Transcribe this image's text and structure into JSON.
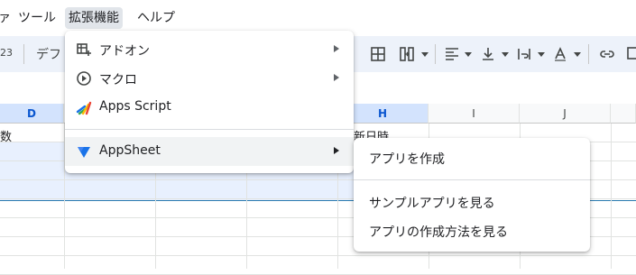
{
  "menubar": {
    "items": [
      {
        "label": "ァ"
      },
      {
        "label": "ツール"
      },
      {
        "label": "拡張機能"
      },
      {
        "label": "ヘルプ"
      }
    ]
  },
  "toolbar": {
    "num_format": "23",
    "font": "デフ"
  },
  "columns": [
    {
      "label": "D"
    },
    {
      "label": ""
    },
    {
      "label": ""
    },
    {
      "label": ""
    },
    {
      "label": "H"
    },
    {
      "label": "I"
    },
    {
      "label": "J"
    },
    {
      "label": ""
    }
  ],
  "cells": {
    "d1": "数",
    "h1": "新日時"
  },
  "extensions_menu": {
    "items": [
      {
        "label": "アドオン",
        "icon": "addon-icon"
      },
      {
        "label": "マクロ",
        "icon": "macro-icon"
      },
      {
        "label": "Apps Script",
        "icon": "apps-script-icon"
      },
      {
        "label": "AppSheet",
        "icon": "appsheet-icon"
      }
    ]
  },
  "appsheet_submenu": {
    "items": [
      {
        "label": "アプリを作成"
      },
      {
        "label": "サンプルアプリを見る"
      },
      {
        "label": "アプリの作成方法を見る"
      }
    ]
  },
  "colors": {
    "menu_active": "#e1e5ea",
    "toolbar_bg": "#edf2fa",
    "selected_header": "#d3e3fd",
    "selection_fill": "#e8f0fe",
    "accent_blue": "#0b57d0"
  }
}
